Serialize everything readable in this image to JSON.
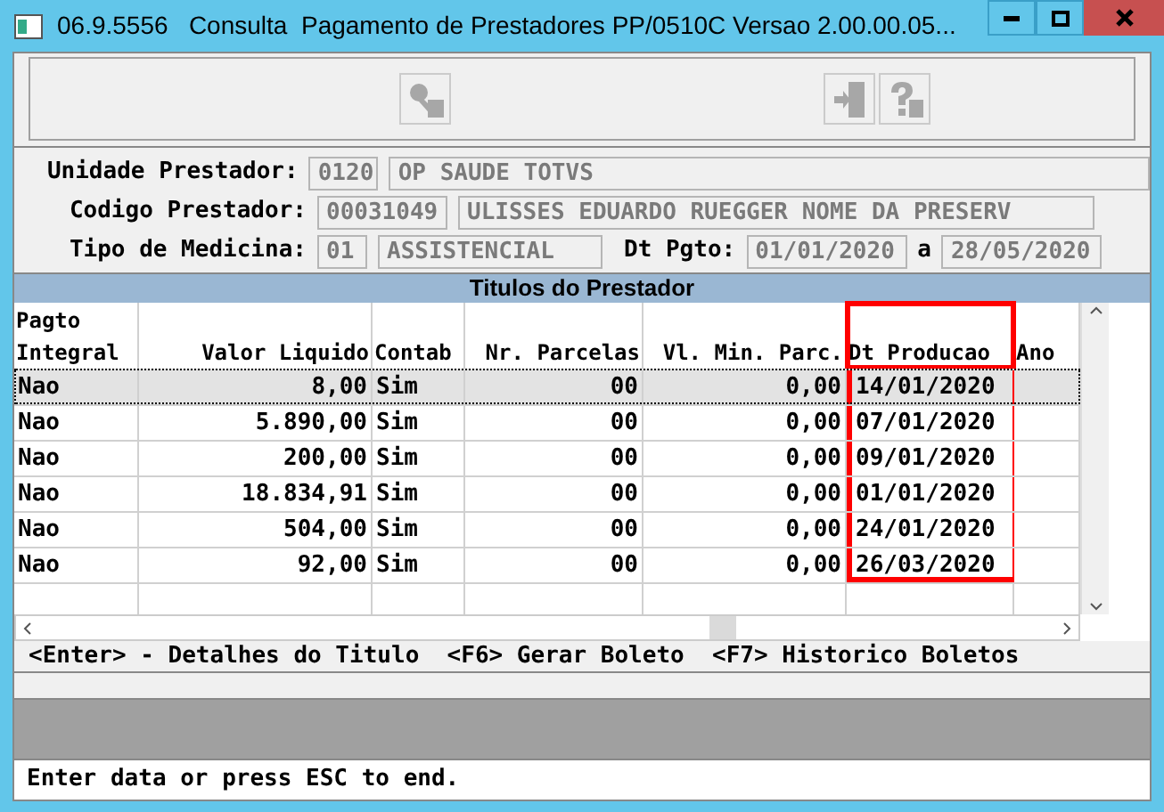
{
  "window": {
    "title": "06.9.5556   Consulta  Pagamento de Prestadores PP/0510C Versao 2.00.00.05..."
  },
  "toolbar": [
    {
      "kind": "key",
      "disabled": true
    },
    {
      "kind": "exit",
      "disabled": true
    },
    {
      "kind": "help",
      "disabled": true
    }
  ],
  "form": [
    {
      "label": "Unidade Prestador:",
      "code": "0120",
      "name": "OP SAUDE TOTVS"
    },
    {
      "label": "Codigo Prestador:",
      "code": "00031049",
      "name": "ULISSES EDUARDO RUEGGER NOME DA PRESERV"
    },
    {
      "label": "Tipo de Medicina:",
      "code": "01",
      "name": "ASSISTENCIAL",
      "date_label": "Dt Pgto:",
      "date_from": "01/01/2020",
      "date_sep": "a",
      "date_to": "28/05/2020"
    }
  ],
  "table": {
    "title": "Titulos do Prestador",
    "columns": [
      {
        "label": "Pagto Integral",
        "kind": "text",
        "highlighted": false
      },
      {
        "label": "Valor Liquido",
        "kind": "number",
        "highlighted": false
      },
      {
        "label": "Contab",
        "kind": "text",
        "highlighted": false
      },
      {
        "label": "Nr. Parcelas",
        "kind": "number",
        "highlighted": false
      },
      {
        "label": "Vl. Min. Parc.",
        "kind": "number",
        "highlighted": false
      },
      {
        "label": "Dt Producao",
        "kind": "text",
        "highlighted": true
      },
      {
        "label": "Ano",
        "kind": "text",
        "highlighted": false
      }
    ],
    "rows": [
      {
        "selected": true,
        "cells": [
          "Nao",
          "8,00",
          "Sim",
          "00",
          "0,00",
          "14/01/2020"
        ]
      },
      {
        "selected": false,
        "cells": [
          "Nao",
          "5.890,00",
          "Sim",
          "00",
          "0,00",
          "07/01/2020"
        ]
      },
      {
        "selected": false,
        "cells": [
          "Nao",
          "200,00",
          "Sim",
          "00",
          "0,00",
          "09/01/2020"
        ]
      },
      {
        "selected": false,
        "cells": [
          "Nao",
          "18.834,91",
          "Sim",
          "00",
          "0,00",
          "01/01/2020"
        ]
      },
      {
        "selected": false,
        "cells": [
          "Nao",
          "504,00",
          "Sim",
          "00",
          "0,00",
          "24/01/2020"
        ]
      },
      {
        "selected": false,
        "cells": [
          "Nao",
          "92,00",
          "Sim",
          "00",
          "0,00",
          "26/03/2020"
        ]
      }
    ],
    "hints": "<Enter> - Detalhes do Titulo  <F6> Gerar Boleto  <F7> Historico Boletos"
  },
  "status_bar": "Enter data or press ESC to end."
}
